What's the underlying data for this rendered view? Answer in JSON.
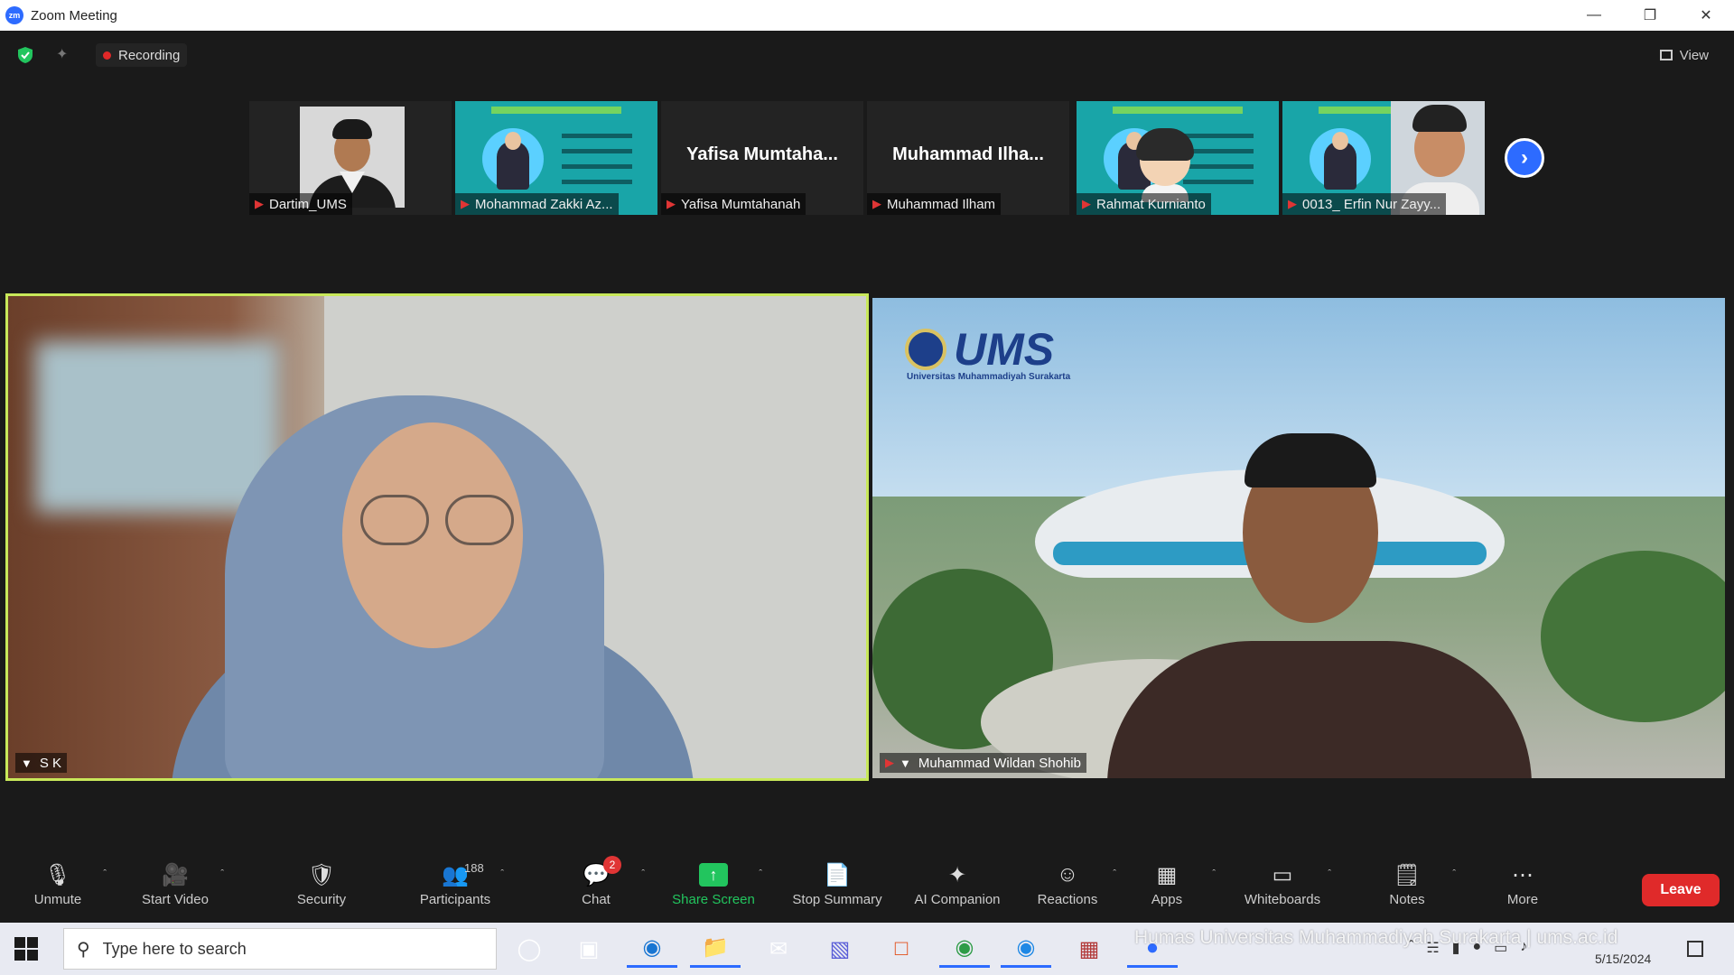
{
  "window": {
    "title": "Zoom Meeting",
    "app_icon_text": "zm"
  },
  "topbar": {
    "recording_label": "Recording",
    "view_label": "View"
  },
  "thumbnails": [
    {
      "name": "Dartim_UMS"
    },
    {
      "name": "Mohammad Zakki Az..."
    },
    {
      "name": "Yafisa Mumtahanah",
      "display": "Yafisa  Mumtaha..."
    },
    {
      "name": "Muhammad Ilham",
      "display": "Muhammad  Ilha..."
    },
    {
      "name": "Rahmat Kurnianto"
    },
    {
      "name": "0013_ Erfin Nur  Zayy..."
    }
  ],
  "main": {
    "left_name": "S K",
    "right_name": "Muhammad Wildan Shohib",
    "ums_logo_text": "UMS",
    "ums_subtitle": "Universitas Muhammadiyah Surakarta"
  },
  "toolbar": {
    "items": [
      {
        "label": "Unmute",
        "icon": "mic-muted-icon"
      },
      {
        "label": "Start Video",
        "icon": "video-off-icon"
      },
      {
        "label": "Security",
        "icon": "shield-icon"
      },
      {
        "label": "Participants",
        "icon": "participants-icon",
        "count": "188"
      },
      {
        "label": "Chat",
        "icon": "chat-icon",
        "badge": "2"
      },
      {
        "label": "Share Screen",
        "icon": "share-screen-icon"
      },
      {
        "label": "Stop Summary",
        "icon": "summary-icon"
      },
      {
        "label": "AI Companion",
        "icon": "sparkle-icon"
      },
      {
        "label": "Reactions",
        "icon": "reactions-icon"
      },
      {
        "label": "Apps",
        "icon": "apps-icon"
      },
      {
        "label": "Whiteboards",
        "icon": "whiteboard-icon"
      },
      {
        "label": "Notes",
        "icon": "notes-icon"
      },
      {
        "label": "More",
        "icon": "more-icon"
      }
    ],
    "leave_label": "Leave"
  },
  "taskbar": {
    "search_placeholder": "Type here to search",
    "watermark": "Humas Universitas Muhammadiyah Surakarta | ums.ac.id",
    "date": "5/15/2024"
  },
  "colors": {
    "accent": "#2d6bff",
    "leave": "#e02a2a",
    "share_green": "#22c55e",
    "active_speaker": "#c8e85a"
  }
}
